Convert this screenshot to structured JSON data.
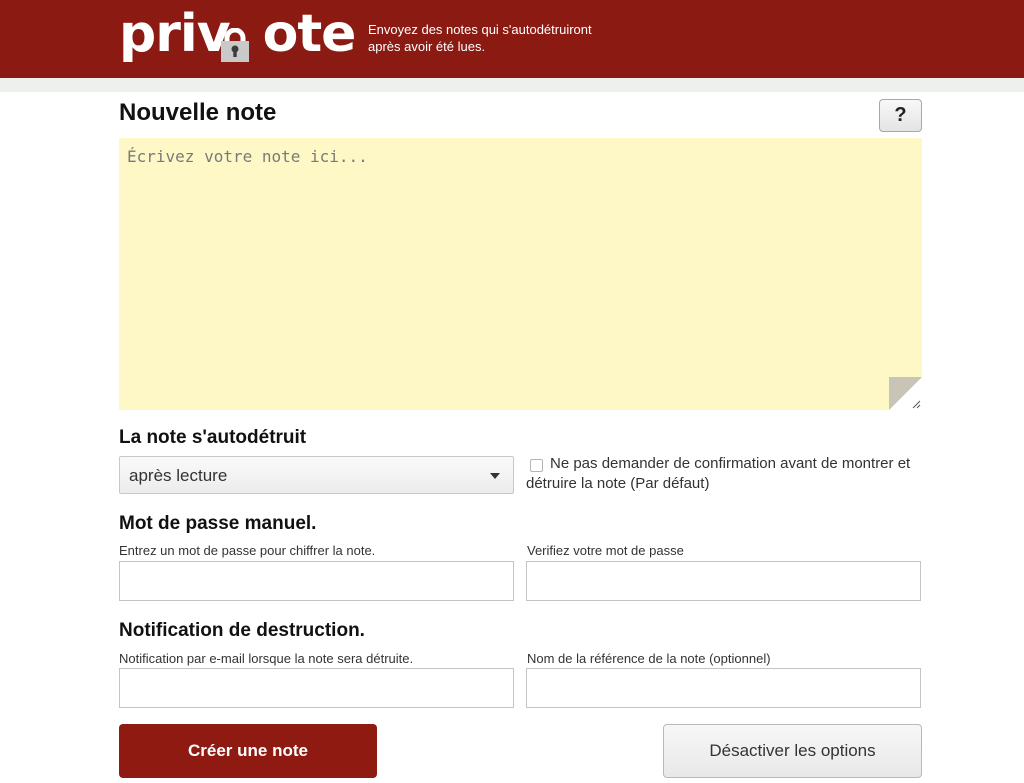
{
  "brand": {
    "logo_text": "privnote",
    "tagline_line1": "Envoyez des notes qui s'autodétruiront",
    "tagline_line2": "après avoir été lues.",
    "header_color": "#8b1a12"
  },
  "note": {
    "title": "Nouvelle note",
    "help_label": "?",
    "placeholder": "Écrivez votre note ici...",
    "value": ""
  },
  "destruct": {
    "title": "La note s'autodétruit",
    "selected_option": "après lecture",
    "checkbox_checked": false,
    "checkbox_label": "Ne pas demander de confirmation avant de montrer et détruire la note (Par défaut)"
  },
  "password": {
    "title": "Mot de passe manuel.",
    "enter_label": "Entrez un mot de passe pour chiffrer la note.",
    "enter_value": "",
    "verify_label": "Verifiez votre mot de passe",
    "verify_value": ""
  },
  "notification": {
    "title": "Notification de destruction.",
    "email_label": "Notification par e-mail lorsque la note sera détruite.",
    "email_value": "",
    "reference_label": "Nom de la référence de la note (optionnel)",
    "reference_value": ""
  },
  "actions": {
    "create_label": "Créer une note",
    "create_color": "#8e1a12",
    "disable_options_label": "Désactiver les options"
  },
  "icons": {
    "logo_lock": "padlock-icon",
    "dropdown": "chevron-down-icon",
    "note_fold": "page-curl-icon",
    "resize": "resize-handle-icon"
  }
}
